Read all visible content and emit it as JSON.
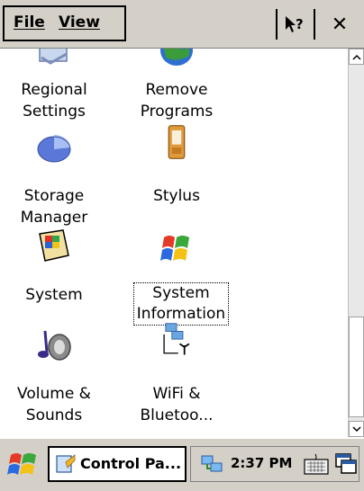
{
  "menu": {
    "file": "File",
    "view": "View"
  },
  "items": [
    {
      "label": "Regional\nSettings",
      "icon": "regional-settings-icon"
    },
    {
      "label": "Remove\nPrograms",
      "icon": "remove-programs-icon"
    },
    {
      "label": "Storage\nManager",
      "icon": "storage-manager-icon"
    },
    {
      "label": "Stylus",
      "icon": "stylus-icon"
    },
    {
      "label": "System",
      "icon": "system-icon"
    },
    {
      "label": "System\nInformation",
      "icon": "system-information-icon"
    },
    {
      "label": "Volume &\nSounds",
      "icon": "volume-sounds-icon"
    },
    {
      "label": "WiFi &\nBluetoo...",
      "icon": "wifi-bluetooth-icon"
    }
  ],
  "selected_item": "System\nInformation",
  "taskbar": {
    "task_label": "Control Pa...",
    "clock": "2:37 PM"
  },
  "colors": {
    "chrome": "#d4d0c8",
    "background": "#ffffff",
    "selection_border": "#000000"
  }
}
